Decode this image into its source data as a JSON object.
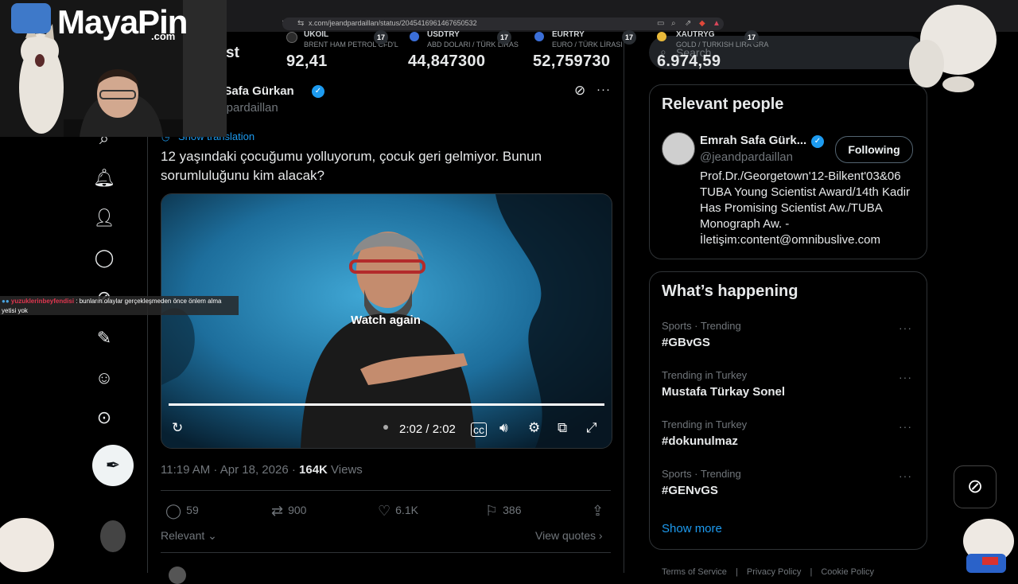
{
  "browser": {
    "url": "x.com/jeandpardaillan/status/2045416961467650532"
  },
  "ticker": [
    {
      "symbol": "UKOIL",
      "desc": "BRENT HAM PETROL CFD'L",
      "value": "92,41",
      "color": "#2b2b2b"
    },
    {
      "symbol": "USDTRY",
      "desc": "ABD DOLARI / TÜRK LİRAS",
      "value": "44,847300",
      "color": "#3b6fd8"
    },
    {
      "symbol": "EURTRY",
      "desc": "EURO / TÜRK LİRASI",
      "value": "52,759730",
      "color": "#3b6fd8"
    },
    {
      "symbol": "XAUTRYG",
      "desc": "GOLD / TURKISH LIRA GRA",
      "value": "6.974,59",
      "color": "#e8b93a"
    }
  ],
  "ticker_badge": "17",
  "search": {
    "placeholder": "Search"
  },
  "page_header": {
    "fragment": "st"
  },
  "overlay": {
    "logo_main": "MayaPin",
    "logo_sub": ".com",
    "chat_user": "yuzuklerinbeyfendisi",
    "chat_text": ": bunların olaylar gerçekleşmeden önce önlem alma",
    "chat_text_2": "yetisi yok"
  },
  "tweet": {
    "author_name": "Emrah Safa Gürkan",
    "author_name_visible": "h Safa Gürkan",
    "author_handle": "@jeandpardaillan",
    "author_handle_visible": "ndpardaillan",
    "show_translation": "Show translation",
    "text": "12 yaşındaki çocuğumu yolluyorum, çocuk geri gelmiyor. Bunun sorumluluğunu kim alacak?",
    "video": {
      "watch_again": "Watch again",
      "time": "2:02 / 2:02",
      "progress": 1.0
    },
    "time": "11:19 AM · Apr 18, 2026",
    "views_count": "164K",
    "views_label": "Views",
    "replies": "59",
    "reposts": "900",
    "likes": "6.1K",
    "bookmarks": "386",
    "sort_label": "Relevant",
    "view_quotes": "View quotes"
  },
  "relevant_people": {
    "title": "Relevant people",
    "name": "Emrah Safa Gürk...",
    "handle": "@jeandpardaillan",
    "bio": "Prof.Dr./Georgetown'12-Bilkent'03&06 TUBA Young Scientist Award/14th Kadir Has Promising Scientist Aw./TUBA Monograph Aw. - İletişim:content@omnibuslive.com",
    "follow_label": "Following"
  },
  "whats_happening": {
    "title": "What’s happening",
    "trends": [
      {
        "category": "Sports · Trending",
        "name": "#GBvGS"
      },
      {
        "category": "Trending in Turkey",
        "name": "Mustafa Türkay Sonel"
      },
      {
        "category": "Trending in Turkey",
        "name": "#dokunulmaz"
      },
      {
        "category": "Sports · Trending",
        "name": "#GENvGS"
      }
    ],
    "show_more": "Show more"
  },
  "footer": {
    "links": [
      "Terms of Service",
      "Privacy Policy",
      "Cookie Policy"
    ]
  },
  "colors": {
    "accent": "#1d9bf0",
    "background": "#000000",
    "muted": "#71767b",
    "border": "#2f3336"
  }
}
